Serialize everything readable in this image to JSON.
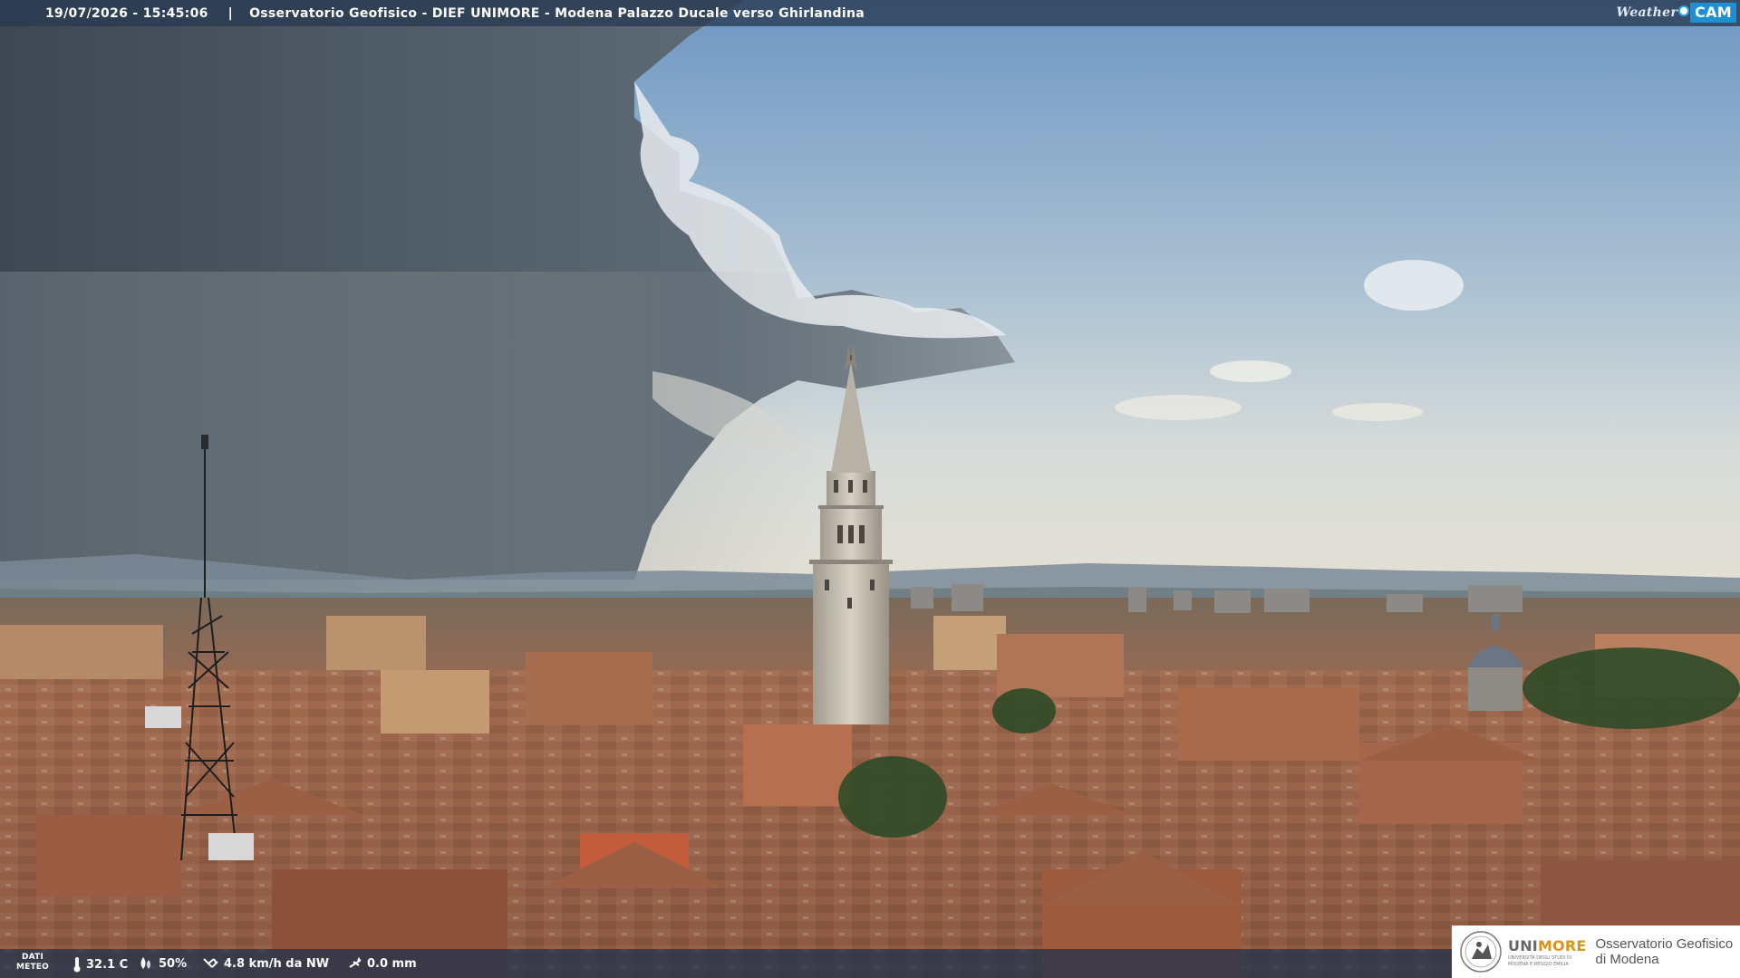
{
  "header": {
    "timestamp": "19/07/2026 - 15:45:06",
    "separator": "|",
    "caption": "Osservatorio Geofisico - DIEF UNIMORE - Modena Palazzo Ducale verso Ghirlandina"
  },
  "brand_logo": {
    "weather": "Weather",
    "cam": "CAM",
    "icon": "weathercam-dot-icon"
  },
  "weather_data": {
    "label_line1": "DATI",
    "label_line2": "METEO",
    "temperature": "32.1 C",
    "humidity": "50%",
    "wind": "4.8 km/h da NW",
    "rain": "0.0 mm",
    "icons": [
      "thermometer-icon",
      "humidity-drop-icon",
      "wind-icon",
      "rain-gauge-icon"
    ]
  },
  "institution_logo": {
    "uni_prefix": "UNI",
    "uni_suffix": "MORE",
    "uni_subtitle_1": "UNIVERSITÀ DEGLI STUDI DI",
    "uni_subtitle_2": "MODENA E REGGIO EMILIA",
    "observatory_line1": "Osservatorio Geofisico",
    "observatory_line2": "di Modena",
    "seal_icon": "university-seal-icon"
  },
  "colors": {
    "overlay_bar": "#283a52",
    "sky_blue": "#6f98c2",
    "storm_cloud": "#4b5966",
    "roof_terracotta": "#a8674a",
    "brand_orange": "#d9941c",
    "brand_blue": "#1e8fd0"
  }
}
